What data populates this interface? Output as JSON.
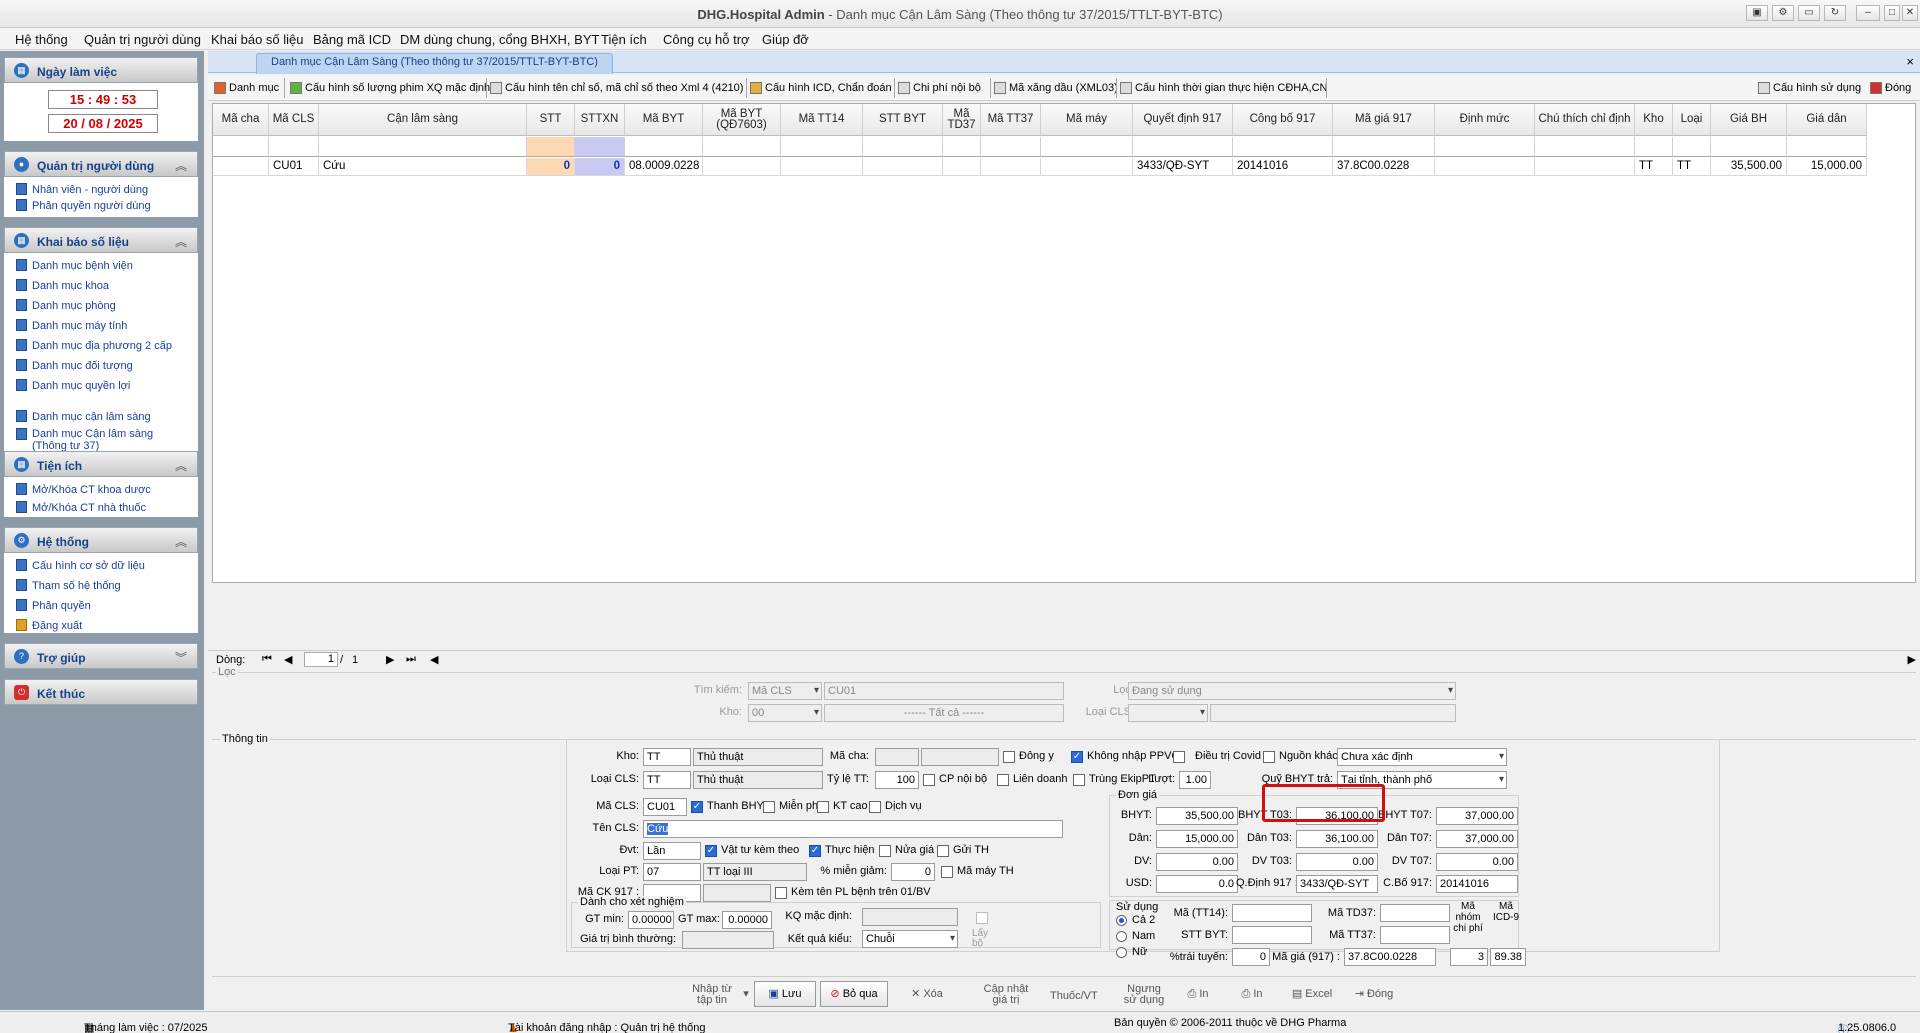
{
  "window": {
    "app": "DHG.Hospital Admin",
    "title": " - Danh mục Cận Lâm Sàng (Theo thông tư 37/2015/TTLT-BYT-BTC)"
  },
  "menu": [
    "Hệ thống",
    "Quản trị người dùng",
    "Khai báo số liệu",
    "Bảng mã ICD",
    "DM dùng chung, cổng BHXH, BYT",
    "Tiện ích",
    "Công cụ hỗ trợ",
    "Giúp đỡ"
  ],
  "sidebar": {
    "work_day": {
      "title": "Ngày làm việc",
      "time": "15 : 49 : 53",
      "date": "20 / 08 / 2025"
    },
    "user_admin": {
      "title": "Quản trị người dùng",
      "items": [
        "Nhân viên - người dùng",
        "Phân quyền người dùng"
      ]
    },
    "data_decl": {
      "title": "Khai báo số liệu",
      "items": [
        "Danh mục bệnh viện",
        "Danh mục khoa",
        "Danh mục phòng",
        "Danh mục máy tính",
        "Danh mục địa phương 2 cấp",
        "Danh mục đối tượng",
        "Danh mục quyền lợi",
        "Danh mục cận lâm sàng",
        "Danh mục Cận lâm sàng",
        "(Thông  tư 37)"
      ]
    },
    "utilities": {
      "title": "Tiện ích",
      "items": [
        "Mở/Khóa CT khoa dược",
        "Mở/Khóa CT nhà thuốc"
      ]
    },
    "system": {
      "title": "Hệ thống",
      "items": [
        "Cấu hình cơ sở dữ liệu",
        "Tham số hệ thống",
        "Phân quyền",
        "Đăng xuất"
      ]
    },
    "help": {
      "title": "Trợ giúp"
    },
    "end": {
      "title": "Kết thúc"
    }
  },
  "tab": {
    "label": "Danh mục Cận Lâm Sàng (Theo thông tư 37/2015/TTLT-BYT-BTC)",
    "close": "×"
  },
  "toolbar": [
    "Danh mục",
    "Cấu hình số lượng phim XQ mặc định",
    "Cấu hình tên chỉ số, mã chỉ số theo Xml 4 (4210)",
    "Cấu hình ICD, Chẩn đoán",
    "Chi phí nội bộ",
    "Mã xăng dầu (XML03)",
    "Cấu hình thời gian thực hiện CĐHA,CN"
  ],
  "toolbar_right": [
    "Cấu hình sử dụng",
    "Đóng"
  ],
  "grid": {
    "headers": [
      "Mã cha",
      "Mã CLS",
      "Cận lâm sàng",
      "STT",
      "STTXN",
      "Mã BYT",
      "Mã BYT (QĐ7603)",
      "Mã TT14",
      "STT BYT",
      "Mã TD37",
      "Mã TT37",
      "Mã máy",
      "Quyết định 917",
      "Công bố 917",
      "Mã giá 917",
      "Định mức",
      "Chú thích chỉ định",
      "Kho",
      "Loại",
      "Giá BH",
      "Giá dân"
    ],
    "row": [
      "",
      "CU01",
      "Cứu",
      "0",
      "0",
      "08.0009.0228",
      "",
      "",
      "",
      "",
      "",
      "",
      "3433/QĐ-SYT",
      "20141016",
      "37.8C00.0228",
      "",
      "",
      "TT",
      "TT",
      "35,500.00",
      "15,000.00"
    ]
  },
  "pager": {
    "label": "Dòng:",
    "page": "1",
    "total": "1"
  },
  "filter": {
    "legend": "Lọc",
    "search_label": "Tìm kiếm:",
    "search_field": "Mã CLS",
    "search_value": "CU01",
    "kho_label": "Kho:",
    "kho_value": "00",
    "kho_text": "------ Tất cả ------",
    "loc_label": "Lọc:",
    "loc_value": "Đang sử dụng",
    "loai_cls_label": "Loại CLS:"
  },
  "info": {
    "legend": "Thông tin",
    "kho_label": "Kho:",
    "kho_code": "TT",
    "kho_name": "Thủ thuật",
    "ma_cha_label": "Mã cha:",
    "dong_y": "Đông y",
    "khong_nhap_ppvc": "Không nhập PPVC",
    "dieu_tri_covid": "Điều trị Covid",
    "nguon_khac": "Nguồn khác",
    "nguon_khac_value": "Chưa xác định",
    "loai_cls_label": "Loại CLS:",
    "loai_cls_code": "TT",
    "loai_cls_name": "Thủ thuật",
    "ty_le_label": "Tỷ lệ TT:",
    "ty_le_value": "100",
    "cp_noi_bo": "CP nội bộ",
    "lien_doanh": "Liên doanh",
    "trung_ekip": "Trùng EkipPT",
    "luot_label": "Lượt:",
    "luot_value": "1.00",
    "quy_bhyt_label": "Quỹ BHYT trả:",
    "quy_bhyt_value": "Tại tỉnh, thành phố",
    "ma_cls_label": "Mã CLS:",
    "ma_cls_value": "CU01",
    "thanh_bhyt": "Thanh BHYT",
    "mien_phi": "Miễn phí",
    "kt_cao": "KT cao",
    "dich_vu": "Dịch vụ",
    "ten_cls_label": "Tên CLS:",
    "ten_cls_value": "Cứu",
    "dvt_label": "Đvt:",
    "dvt_value": "Lần",
    "vat_tu": "Vật tư kèm theo",
    "thuc_hien": "Thực hiện",
    "nua_gia": "Nửa giá",
    "gui_th": "Gửi TH",
    "loai_pt_label": "Loại PT:",
    "loai_pt_code": "07",
    "loai_pt_name": "TT loại III",
    "mien_giam_label": "% miễn giảm:",
    "mien_giam_value": "0",
    "ma_may_th": "Mã máy TH",
    "ma_ck_label": "Mã CK 917 :",
    "kem_ten": "Kèm tên PL bệnh trên 01/BV",
    "xn_legend": "Dành cho xét nghiệm",
    "gt_min_label": "GT min:",
    "gt_min_value": "0.00000",
    "gt_max_label": "GT max:",
    "gt_max_value": "0.00000",
    "kq_mac_dinh_label": "KQ mặc định:",
    "gt_binh_thuong_label": "Giá trị bình thường:",
    "ket_qua_kieu_label": "Kết quả kiểu:",
    "ket_qua_kieu_value": "Chuỗi",
    "lay_bo": "Lấy bộ"
  },
  "price": {
    "legend": "Đơn giá",
    "bhyt_label": "BHYT:",
    "bhyt": "35,500.00",
    "bhyt_t03_label": "BHYT T03:",
    "bhyt_t03": "36,100.00",
    "bhyt_t07_label": "BHYT T07:",
    "bhyt_t07": "37,000.00",
    "dan_label": "Dân:",
    "dan": "15,000.00",
    "dan_t03_label": "Dân T03:",
    "dan_t03": "36,100.00",
    "dan_t07_label": "Dân T07:",
    "dan_t07": "37,000.00",
    "dv_label": "DV:",
    "dv": "0.00",
    "dv_t03_label": "DV T03:",
    "dv_t03": "0.00",
    "dv_t07_label": "DV T07:",
    "dv_t07": "0.00",
    "usd_label": "USD:",
    "usd": "0.0",
    "qd917_label": "Q.Định 917 :",
    "qd917": "3433/QĐ-SYT",
    "cbo917_label": "C.Bố 917:",
    "cbo917": "20141016"
  },
  "usage": {
    "legend": "Sử dụng",
    "both": "Cả 2",
    "male": "Nam",
    "female": "Nữ",
    "ma_tt14_label": "Mã (TT14):",
    "ma_td37_label": "Mã TD37:",
    "stt_byt_label": "STT BYT:",
    "ma_tt37_label": "Mã TT37:",
    "trai_tuyen_label": "%trái tuyến:",
    "trai_tuyen": "0",
    "ma_gia_label": "Mã giá (917) :",
    "ma_gia": "37.8C00.0228",
    "nhom_label": "Mã nhóm chi phí",
    "nhom": "3",
    "icd9_label": "Mã ICD-9",
    "icd9": "89.38"
  },
  "actions": [
    "Nhập từ tập tin",
    "Lưu",
    "Bỏ qua",
    "Xóa",
    "Cập nhật giá trị",
    "Thuốc/VT",
    "Ngưng sử dụng",
    "In",
    "In",
    "Excel",
    "Đóng"
  ],
  "status": {
    "month": "Tháng làm việc : 07/2025",
    "account": "Tài khoản đăng nhập : Quản trị hệ thống",
    "copyright": "Bản quyền © 2006-2011 thuộc về DHG Pharma",
    "version": "1.25.0806.0"
  }
}
